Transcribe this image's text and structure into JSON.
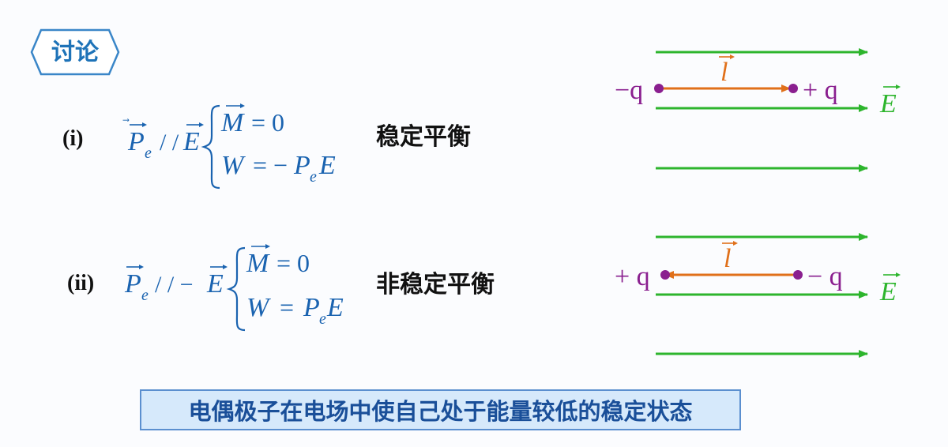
{
  "badge": {
    "text": "讨论"
  },
  "case1": {
    "label": "(i)",
    "condition": {
      "P": "P",
      "sub": "e",
      "rel": "/ /",
      "E": "E"
    },
    "line1": {
      "M": "M",
      "eq": "= 0"
    },
    "line2": {
      "W": "W",
      "eq": "= −",
      "P": "P",
      "sub": "e",
      "E": "E"
    },
    "description": "稳定平衡"
  },
  "case2": {
    "label": "(ii)",
    "condition": {
      "P": "P",
      "sub": "e",
      "rel": "/ / −",
      "E": "E"
    },
    "line1": {
      "M": "M",
      "eq": "= 0"
    },
    "line2": {
      "W": "W",
      "eq": "=",
      "P": "P",
      "sub": "e",
      "E": "E"
    },
    "description": "非稳定平衡"
  },
  "diagram1": {
    "left_charge": "−q",
    "right_charge": "+ q",
    "vector_l": "l",
    "field": "E"
  },
  "diagram2": {
    "left_charge": "+ q",
    "right_charge": "− q",
    "vector_l": "l",
    "field": "E"
  },
  "summary": {
    "text": "电偶极子在电场中使自己处于能量较低的稳定状态"
  },
  "colors": {
    "field": "#2db52d",
    "dipole": "#e0701a",
    "charge": "#8a1f8f",
    "formula": "#1a63b0",
    "badge": "#1e73b8"
  }
}
